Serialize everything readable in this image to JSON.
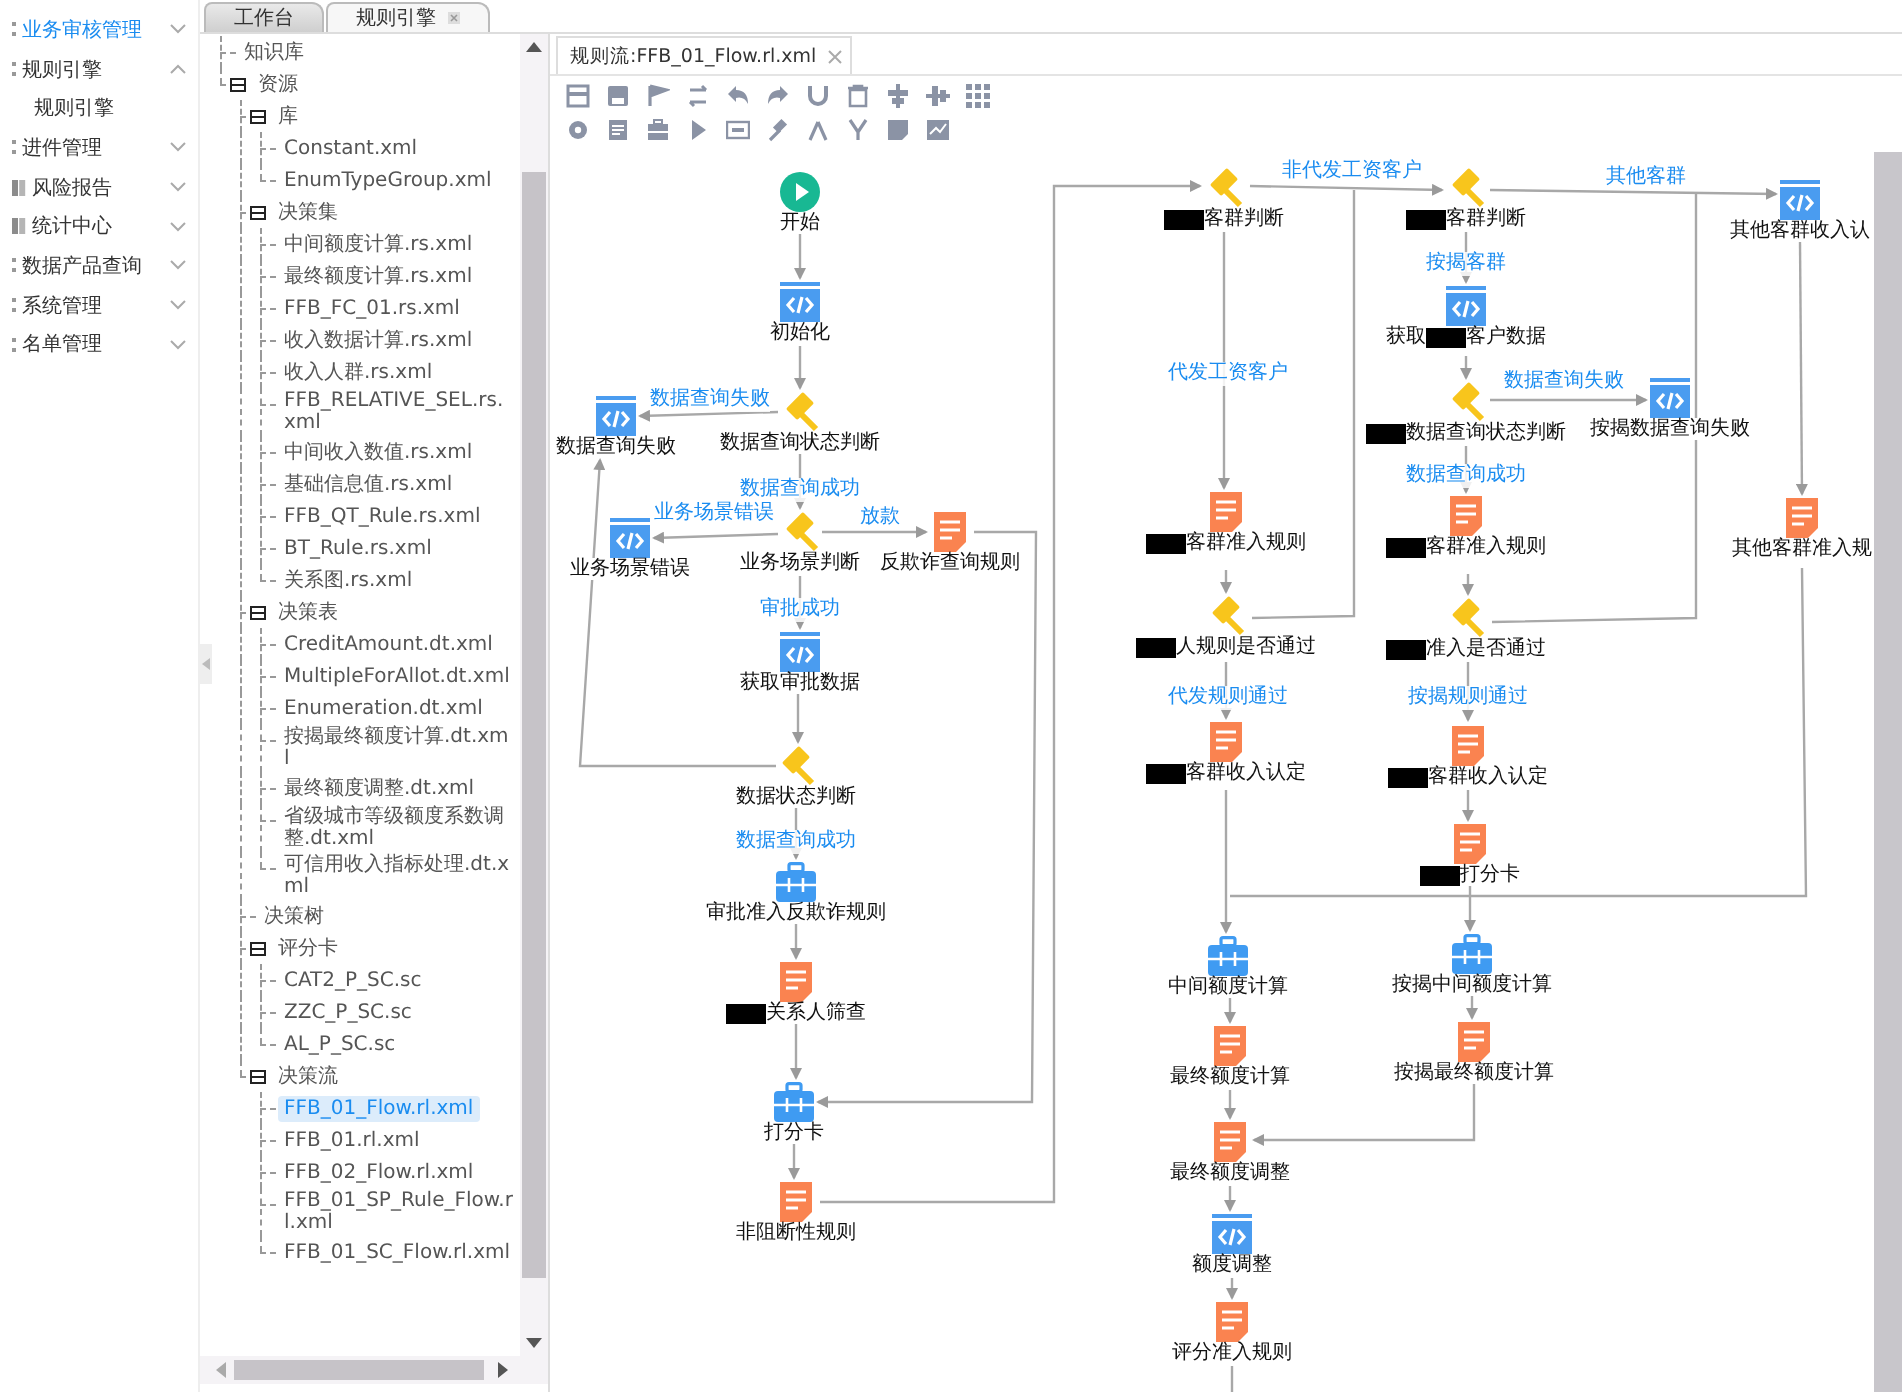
{
  "menu": {
    "items": [
      {
        "label": "业务审核管理",
        "kind": "plain",
        "selected": true,
        "expanded": false
      },
      {
        "label": "规则引擎",
        "kind": "plain",
        "selected": false,
        "expanded": true,
        "children": [
          {
            "label": "规则引擎",
            "selected": false
          }
        ]
      },
      {
        "label": "进件管理",
        "kind": "plain",
        "selected": false,
        "expanded": false
      },
      {
        "label": "风险报告",
        "kind": "book",
        "selected": false,
        "expanded": false
      },
      {
        "label": "统计中心",
        "kind": "book",
        "selected": false,
        "expanded": false
      },
      {
        "label": "数据产品查询",
        "kind": "plain",
        "selected": false,
        "expanded": false
      },
      {
        "label": "系统管理",
        "kind": "plain",
        "selected": false,
        "expanded": false
      },
      {
        "label": "名单管理",
        "kind": "plain",
        "selected": false,
        "expanded": false
      }
    ]
  },
  "top_tabs": [
    {
      "label": "工作台",
      "selected": false
    },
    {
      "label": "规则引擎",
      "selected": true
    }
  ],
  "tree": {
    "items": [
      {
        "label": "知识库",
        "selected": false
      },
      {
        "label": "资源",
        "selected": false,
        "expanded": true,
        "children": [
          {
            "label": "库",
            "selected": false,
            "expanded": true,
            "children": [
              {
                "label": "Constant.xml",
                "selected": false
              },
              {
                "label": "EnumTypeGroup.xml",
                "selected": false
              }
            ]
          },
          {
            "label": "决策集",
            "selected": false,
            "expanded": true,
            "children": [
              {
                "label": "中间额度计算.rs.xml",
                "selected": false
              },
              {
                "label": "最终额度计算.rs.xml",
                "selected": false
              },
              {
                "label": "FFB_FC_01.rs.xml",
                "selected": false
              },
              {
                "label": "收入数据计算.rs.xml",
                "selected": false
              },
              {
                "label": "收入人群.rs.xml",
                "selected": false
              },
              {
                "label": "FFB_RELATIVE_SEL.rs.xml",
                "selected": false
              },
              {
                "label": "中间收入数值.rs.xml",
                "selected": false
              },
              {
                "label": "基础信息值.rs.xml",
                "selected": false
              },
              {
                "label": "FFB_QT_Rule.rs.xml",
                "selected": false
              },
              {
                "label": "BT_Rule.rs.xml",
                "selected": false
              },
              {
                "label": "关系图.rs.xml",
                "selected": false
              }
            ]
          },
          {
            "label": "决策表",
            "selected": false,
            "expanded": true,
            "children": [
              {
                "label": "CreditAmount.dt.xml",
                "selected": false
              },
              {
                "label": "MultipleForAllot.dt.xml",
                "selected": false
              },
              {
                "label": "Enumeration.dt.xml",
                "selected": false
              },
              {
                "label": "按揭最终额度计算.dt.xml",
                "selected": false
              },
              {
                "label": "最终额度调整.dt.xml",
                "selected": false
              },
              {
                "label": "省级城市等级额度系数调整.dt.xml",
                "selected": false
              },
              {
                "label": "可信用收入指标处理.dt.xml",
                "selected": false
              }
            ]
          },
          {
            "label": "决策树",
            "selected": false
          },
          {
            "label": "评分卡",
            "selected": false,
            "expanded": true,
            "children": [
              {
                "label": "CAT2_P_SC.sc",
                "selected": false
              },
              {
                "label": "ZZC_P_SC.sc",
                "selected": false
              },
              {
                "label": "AL_P_SC.sc",
                "selected": false
              }
            ]
          },
          {
            "label": "决策流",
            "selected": false,
            "expanded": true,
            "children": [
              {
                "label": "FFB_01_Flow.rl.xml",
                "selected": true
              },
              {
                "label": "FFB_01.rl.xml",
                "selected": false
              },
              {
                "label": "FFB_02_Flow.rl.xml",
                "selected": false
              },
              {
                "label": "FFB_01_SP_Rule_Flow.rl.xml",
                "selected": false
              },
              {
                "label": "FFB_01_SC_Flow.rl.xml",
                "selected": false
              }
            ]
          }
        ]
      }
    ]
  },
  "editor_tab": {
    "label": "规则流:FFB_01_Flow.rl.xml"
  },
  "flow": {
    "nodes": [
      {
        "kind": "start",
        "segments": [
          {
            "text": "开始"
          }
        ]
      },
      {
        "kind": "script",
        "segments": [
          {
            "text": "初始化"
          }
        ]
      },
      {
        "kind": "script",
        "segments": [
          {
            "text": "数据查询失败"
          }
        ]
      },
      {
        "kind": "decision",
        "segments": [
          {
            "text": "数据查询状态判断"
          }
        ]
      },
      {
        "kind": "script",
        "segments": [
          {
            "text": "业务场景错误"
          }
        ]
      },
      {
        "kind": "decision",
        "segments": [
          {
            "text": "业务场景判断"
          }
        ]
      },
      {
        "kind": "rule",
        "segments": [
          {
            "text": "反欺诈查询规则"
          }
        ]
      },
      {
        "kind": "script",
        "segments": [
          {
            "text": "获取审批数据"
          }
        ]
      },
      {
        "kind": "decision",
        "segments": [
          {
            "text": "数据状态判断"
          }
        ]
      },
      {
        "kind": "package",
        "segments": [
          {
            "text": "审批准入反欺诈规则"
          }
        ]
      },
      {
        "kind": "rule",
        "segments": [
          {
            "redacted": true
          },
          {
            "text": "关系人筛查"
          }
        ]
      },
      {
        "kind": "package",
        "segments": [
          {
            "text": "打分卡"
          }
        ]
      },
      {
        "kind": "rule",
        "segments": [
          {
            "text": "非阻断性规则"
          }
        ]
      },
      {
        "kind": "decision",
        "segments": [
          {
            "redacted": true
          },
          {
            "text": "客群判断"
          }
        ]
      },
      {
        "kind": "decision",
        "segments": [
          {
            "redacted": true
          },
          {
            "text": "客群判断"
          }
        ]
      },
      {
        "kind": "script",
        "segments": [
          {
            "text": "其他客群收入认"
          }
        ]
      },
      {
        "kind": "script",
        "segments": [
          {
            "text": "获取"
          },
          {
            "redacted": true
          },
          {
            "text": "客户数据"
          }
        ]
      },
      {
        "kind": "decision",
        "segments": [
          {
            "redacted": true
          },
          {
            "text": "数据查询状态判断"
          }
        ]
      },
      {
        "kind": "script",
        "segments": [
          {
            "text": "按揭数据查询失败"
          }
        ]
      },
      {
        "kind": "rule",
        "segments": [
          {
            "redacted": true
          },
          {
            "text": "客群准入规则"
          }
        ]
      },
      {
        "kind": "rule",
        "segments": [
          {
            "redacted": true
          },
          {
            "text": "客群准入规则"
          }
        ]
      },
      {
        "kind": "rule",
        "segments": [
          {
            "text": "其他客群准入规"
          }
        ]
      },
      {
        "kind": "decision",
        "segments": [
          {
            "redacted": true
          },
          {
            "text": "人规则是否通过"
          }
        ]
      },
      {
        "kind": "decision",
        "segments": [
          {
            "redacted": true
          },
          {
            "text": "准入是否通过"
          }
        ]
      },
      {
        "kind": "rule",
        "segments": [
          {
            "redacted": true
          },
          {
            "text": "客群收入认定"
          }
        ]
      },
      {
        "kind": "rule",
        "segments": [
          {
            "redacted": true
          },
          {
            "text": "客群收入认定"
          }
        ]
      },
      {
        "kind": "rule",
        "segments": [
          {
            "redacted": true
          },
          {
            "text": "打分卡"
          }
        ]
      },
      {
        "kind": "package",
        "segments": [
          {
            "text": "中间额度计算"
          }
        ]
      },
      {
        "kind": "package",
        "segments": [
          {
            "text": "按揭中间额度计算"
          }
        ]
      },
      {
        "kind": "rule",
        "segments": [
          {
            "text": "最终额度计算"
          }
        ]
      },
      {
        "kind": "rule",
        "segments": [
          {
            "text": "按揭最终额度计算"
          }
        ]
      },
      {
        "kind": "rule",
        "segments": [
          {
            "text": "最终额度调整"
          }
        ]
      },
      {
        "kind": "script",
        "segments": [
          {
            "text": "额度调整"
          }
        ]
      },
      {
        "kind": "rule",
        "segments": [
          {
            "text": "评分准入规则"
          }
        ]
      }
    ],
    "edge_labels": [
      "数据查询失败",
      "数据查询成功",
      "业务场景错误",
      "放款",
      "审批成功",
      "数据查询成功",
      "非代发工资客户",
      "其他客群",
      "代发工资客户",
      "按揭客群",
      "数据查询失败",
      "数据查询成功",
      "代发规则通过",
      "按揭规则通过"
    ]
  }
}
